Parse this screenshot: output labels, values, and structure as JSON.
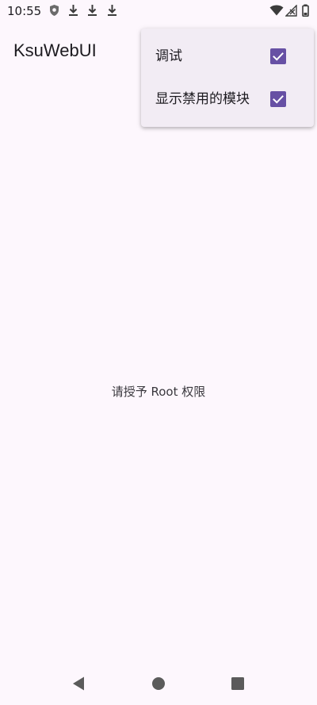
{
  "status_bar": {
    "time": "10:55",
    "left_icons": [
      "shield-icon",
      "download-icon",
      "download-icon",
      "download-icon"
    ],
    "right_icons": [
      "wifi-icon",
      "signal-off-icon",
      "battery-icon"
    ]
  },
  "app_bar": {
    "title": "KsuWebUI"
  },
  "overflow_menu": {
    "items": [
      {
        "label": "调试",
        "checked": true
      },
      {
        "label": "显示禁用的模块",
        "checked": true
      }
    ]
  },
  "main": {
    "message": "请授予 Root 权限"
  },
  "navigation_bar": {
    "buttons": [
      "back-icon",
      "home-icon",
      "recents-icon"
    ]
  },
  "colors": {
    "background": "#fdf7fd",
    "menu_surface": "#f2ecf4",
    "accent": "#6750a4",
    "text": "#1d1b20",
    "nav_icon": "#5b5b5b"
  }
}
